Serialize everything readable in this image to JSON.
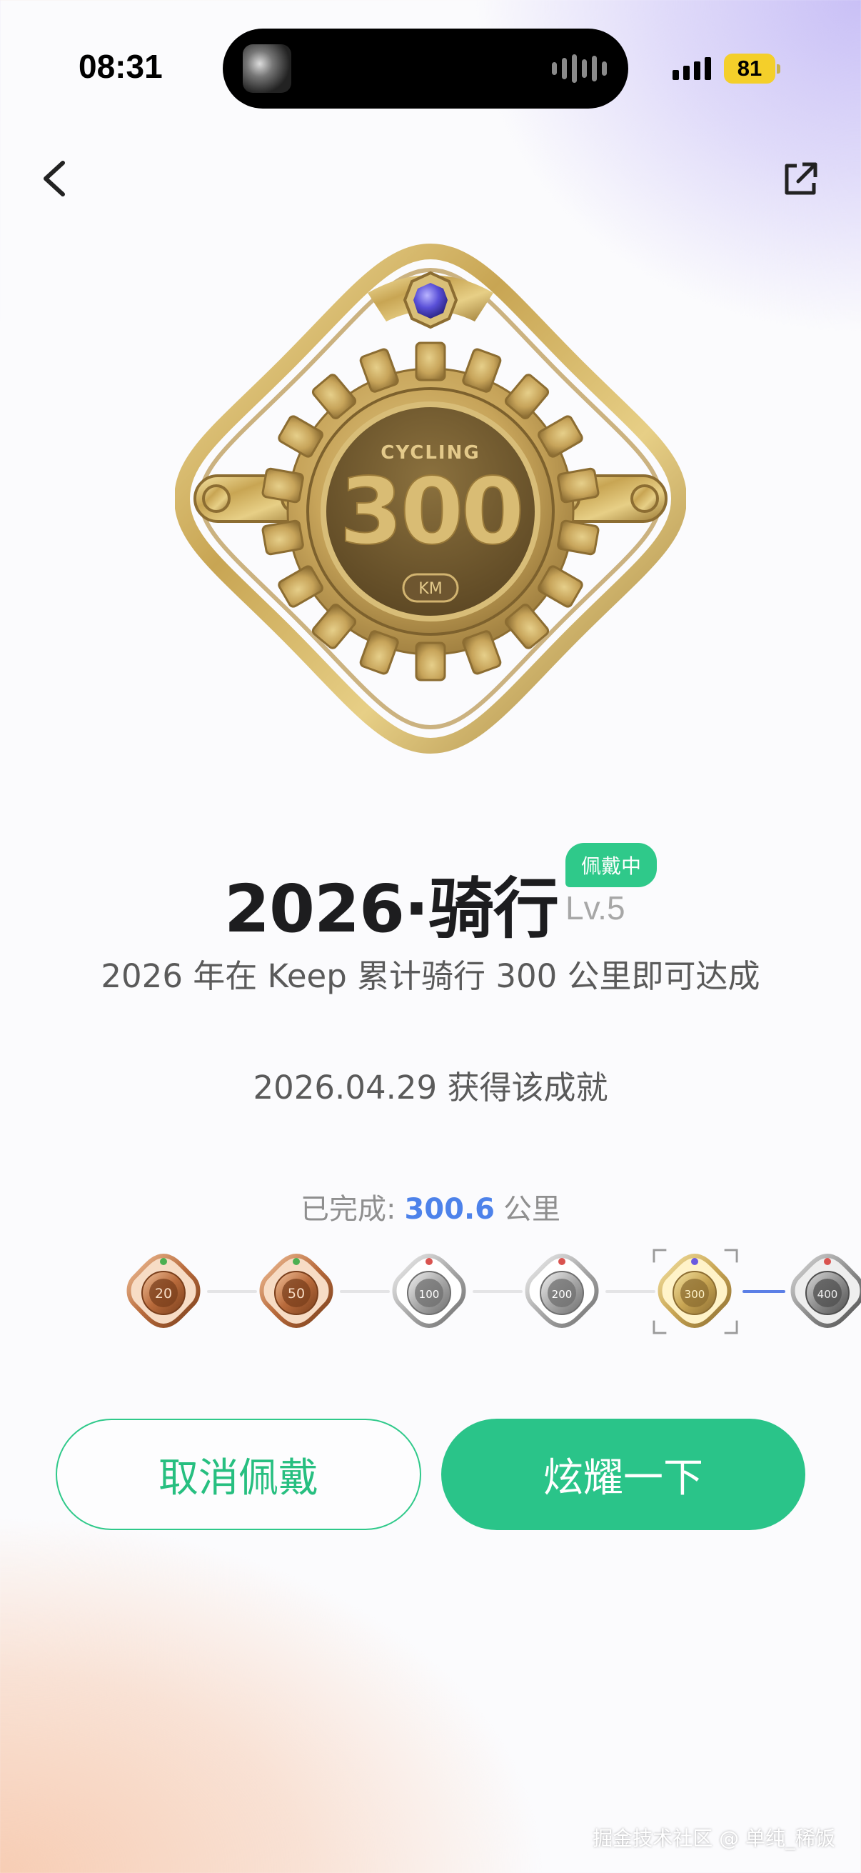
{
  "status_bar": {
    "time": "08:31",
    "battery": "81"
  },
  "nav": {
    "back_icon": "chevron-left-icon",
    "share_icon": "external-share-icon"
  },
  "badge": {
    "top_text": "CYCLING",
    "number": "300",
    "unit": "KM"
  },
  "title": {
    "name": "2026·骑行",
    "level": "Lv.5",
    "wearing_tag": "佩戴中"
  },
  "description": "2026 年在 Keep 累计骑行 300 公里即可达成",
  "obtained_date": "2026.04.29 获得该成就",
  "progress": {
    "label": "已完成:",
    "value": "300.6",
    "unit": "公里"
  },
  "levels": [
    {
      "value": "20",
      "tier": "bronze"
    },
    {
      "value": "50",
      "tier": "bronze"
    },
    {
      "value": "100",
      "tier": "silver"
    },
    {
      "value": "200",
      "tier": "silver"
    },
    {
      "value": "300",
      "tier": "gold",
      "selected": true
    },
    {
      "value": "400",
      "tier": "gray"
    }
  ],
  "colors": {
    "accent_green": "#2ac489",
    "progress_blue": "#4d82ea",
    "badge_gold": "#c9a75a"
  },
  "buttons": {
    "cancel_label": "取消佩戴",
    "share_label": "炫耀一下"
  },
  "watermark": "掘金技术社区 @ 单纯_稀饭"
}
